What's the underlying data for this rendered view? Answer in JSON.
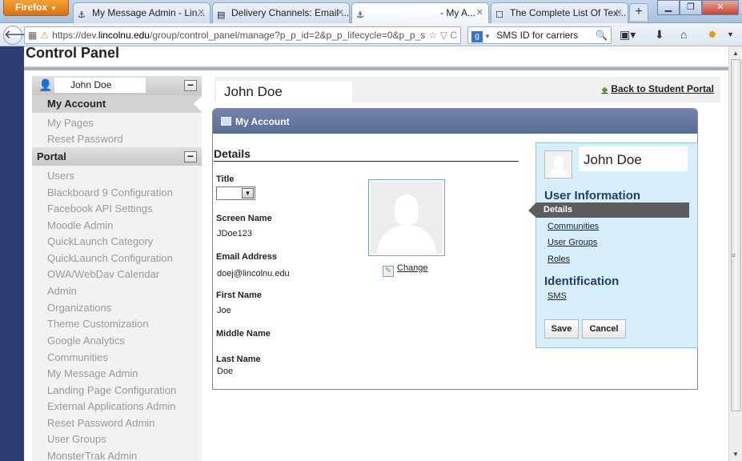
{
  "browser": {
    "app_button": "Firefox",
    "tabs": [
      {
        "title": "My Message Admin - Lin..."
      },
      {
        "title": "Delivery Channels: Email ..."
      },
      {
        "title": "- My A..."
      },
      {
        "title": "The Complete List Of Tex..."
      }
    ],
    "url_prefix": "https://dev.",
    "url_domain": "lincolnu.edu",
    "url_path": "/group/control_panel/manage?p_p_id=2&p_p_lifecycle=0&p_p_st",
    "search_value": "SMS ID for carriers"
  },
  "page": {
    "title": "Control Panel"
  },
  "sidebar": {
    "user_name": "John Doe",
    "my_account": "My Account",
    "account_links": [
      "My Pages",
      "Reset Password"
    ],
    "portal_label": "Portal",
    "portal_links": [
      "Users",
      "Blackboard 9 Configuration",
      "Facebook API Settings",
      "Moodle Admin",
      "QuickLaunch Category",
      "QuickLaunch Configuration",
      "OWA/WebDav Calendar",
      "Admin",
      "Organizations",
      "Theme Customization",
      "Google Analytics",
      "Communities",
      "My Message Admin",
      "Landing Page Configuration",
      "External Applications Admin",
      "Reset Password Admin",
      "User Groups",
      "MonsterTrak Admin"
    ]
  },
  "main": {
    "user_name": "John Doe",
    "back_link": "Back to Student Portal",
    "portlet_title": "My Account",
    "details_heading": "Details",
    "fields": {
      "title_label": "Title",
      "screen_name_label": "Screen Name",
      "screen_name_value": "JDoe123",
      "email_label": "Email Address",
      "email_value": "doej@lincolnu.edu",
      "first_name_label": "First Name",
      "first_name_value": "Joe",
      "middle_name_label": "Middle Name",
      "last_name_label": "Last Name",
      "last_name_value": "Doe"
    },
    "change_link": "Change"
  },
  "info_panel": {
    "user_name": "John Doe",
    "user_info_heading": "User Information",
    "selected_item": "Details",
    "user_info_links": [
      "Communities",
      "User Groups",
      "Roles"
    ],
    "identification_heading": "Identification",
    "identification_links": [
      "SMS"
    ],
    "save_label": "Save",
    "cancel_label": "Cancel"
  },
  "colors": {
    "portlet_header": "#5a6d96",
    "info_panel_bg": "#d7eefb",
    "heading_blue": "#1f3f70",
    "selected_item_bg": "#5d5d5d"
  }
}
